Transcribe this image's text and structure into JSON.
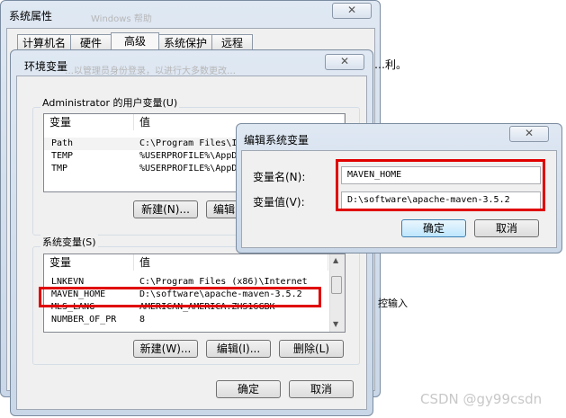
{
  "sysprop": {
    "title": "系统属性",
    "tabs": [
      "计算机名",
      "硬件",
      "高级",
      "系统保护",
      "远程"
    ],
    "bg_heading": "Windows 帮助",
    "bg_line": "…利。",
    "bg_line2": "控输入",
    "ok": "确定",
    "cancel": "取消"
  },
  "envvars": {
    "title": "环境变量",
    "faint_header": "…以管理员身份登录，以进行大多数更改…",
    "user_group_label": "Administrator 的用户变量(U)",
    "col_var": "变量",
    "col_val": "值",
    "user_rows": [
      {
        "name": "Path",
        "value": "C:\\Program Files\\I"
      },
      {
        "name": "TEMP",
        "value": "%USERPROFILE%\\AppD"
      },
      {
        "name": "TMP",
        "value": "%USERPROFILE%\\AppD"
      }
    ],
    "user_new": "新建(N)...",
    "user_edit": "编辑",
    "sys_group_label": "系统变量(S)",
    "sys_rows": [
      {
        "name": "LNKEVN",
        "value": "C:\\Program Files (x86)\\Internet"
      },
      {
        "name": "MAVEN_HOME",
        "value": "D:\\software\\apache-maven-3.5.2"
      },
      {
        "name": "MLS_LANG",
        "value": "AMERICAN_AMERICA.ZHS16GBK"
      },
      {
        "name": "NUMBER_OF_PR",
        "value": "8"
      }
    ],
    "sys_new": "新建(W)...",
    "sys_edit": "编辑(I)...",
    "sys_delete": "删除(L)",
    "ok": "确定",
    "cancel": "取消"
  },
  "editvar": {
    "title": "编辑系统变量",
    "name_label": "变量名(N):",
    "name_value": "MAVEN_HOME",
    "value_label": "变量值(V):",
    "value_value": "D:\\software\\apache-maven-3.5.2",
    "ok": "确定",
    "cancel": "取消"
  },
  "close_glyph": "✕",
  "watermark": "CSDN @gy99csdn",
  "colors": {
    "highlight": "#e00000",
    "dialog_bg": "#f0f0f0"
  }
}
